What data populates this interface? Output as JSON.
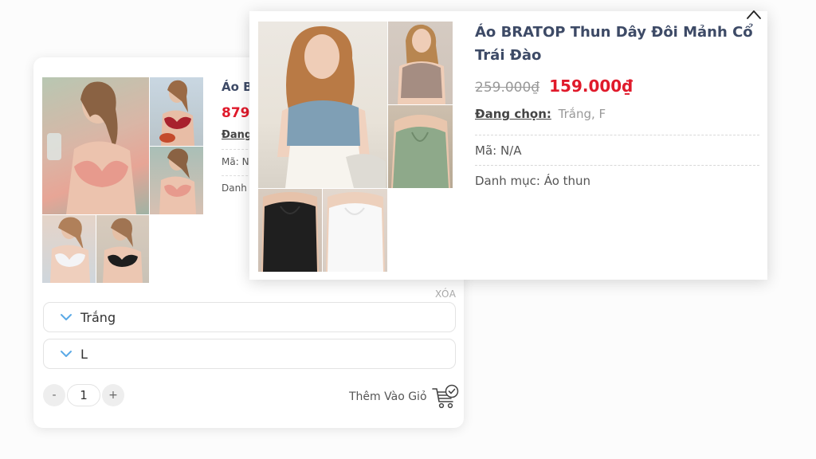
{
  "back_card": {
    "title": "Áo B",
    "price": "879.",
    "selected_label": "Đang",
    "code_label": "Mã: N",
    "category_label": "Danh",
    "remove_label": "XÓA",
    "color_select": "Trắng",
    "size_select": "L",
    "quantity": "1",
    "minus_label": "-",
    "plus_label": "+",
    "add_to_cart_label": "Thêm Vào Giỏ"
  },
  "quick_view": {
    "title": "Áo BRATOP Thun Dây Đôi Mảnh Cổ Trái Đào",
    "old_price": "259.000₫",
    "new_price": "159.000₫",
    "selected_label": "Đang chọn:",
    "selected_value": "Trắng, F",
    "code": "Mã: N/A",
    "category": "Danh mục: Áo thun"
  },
  "colors": {
    "price_red": "#e01a2b",
    "title_navy": "#3d4a66",
    "chevron_blue": "#5aa9e6"
  }
}
